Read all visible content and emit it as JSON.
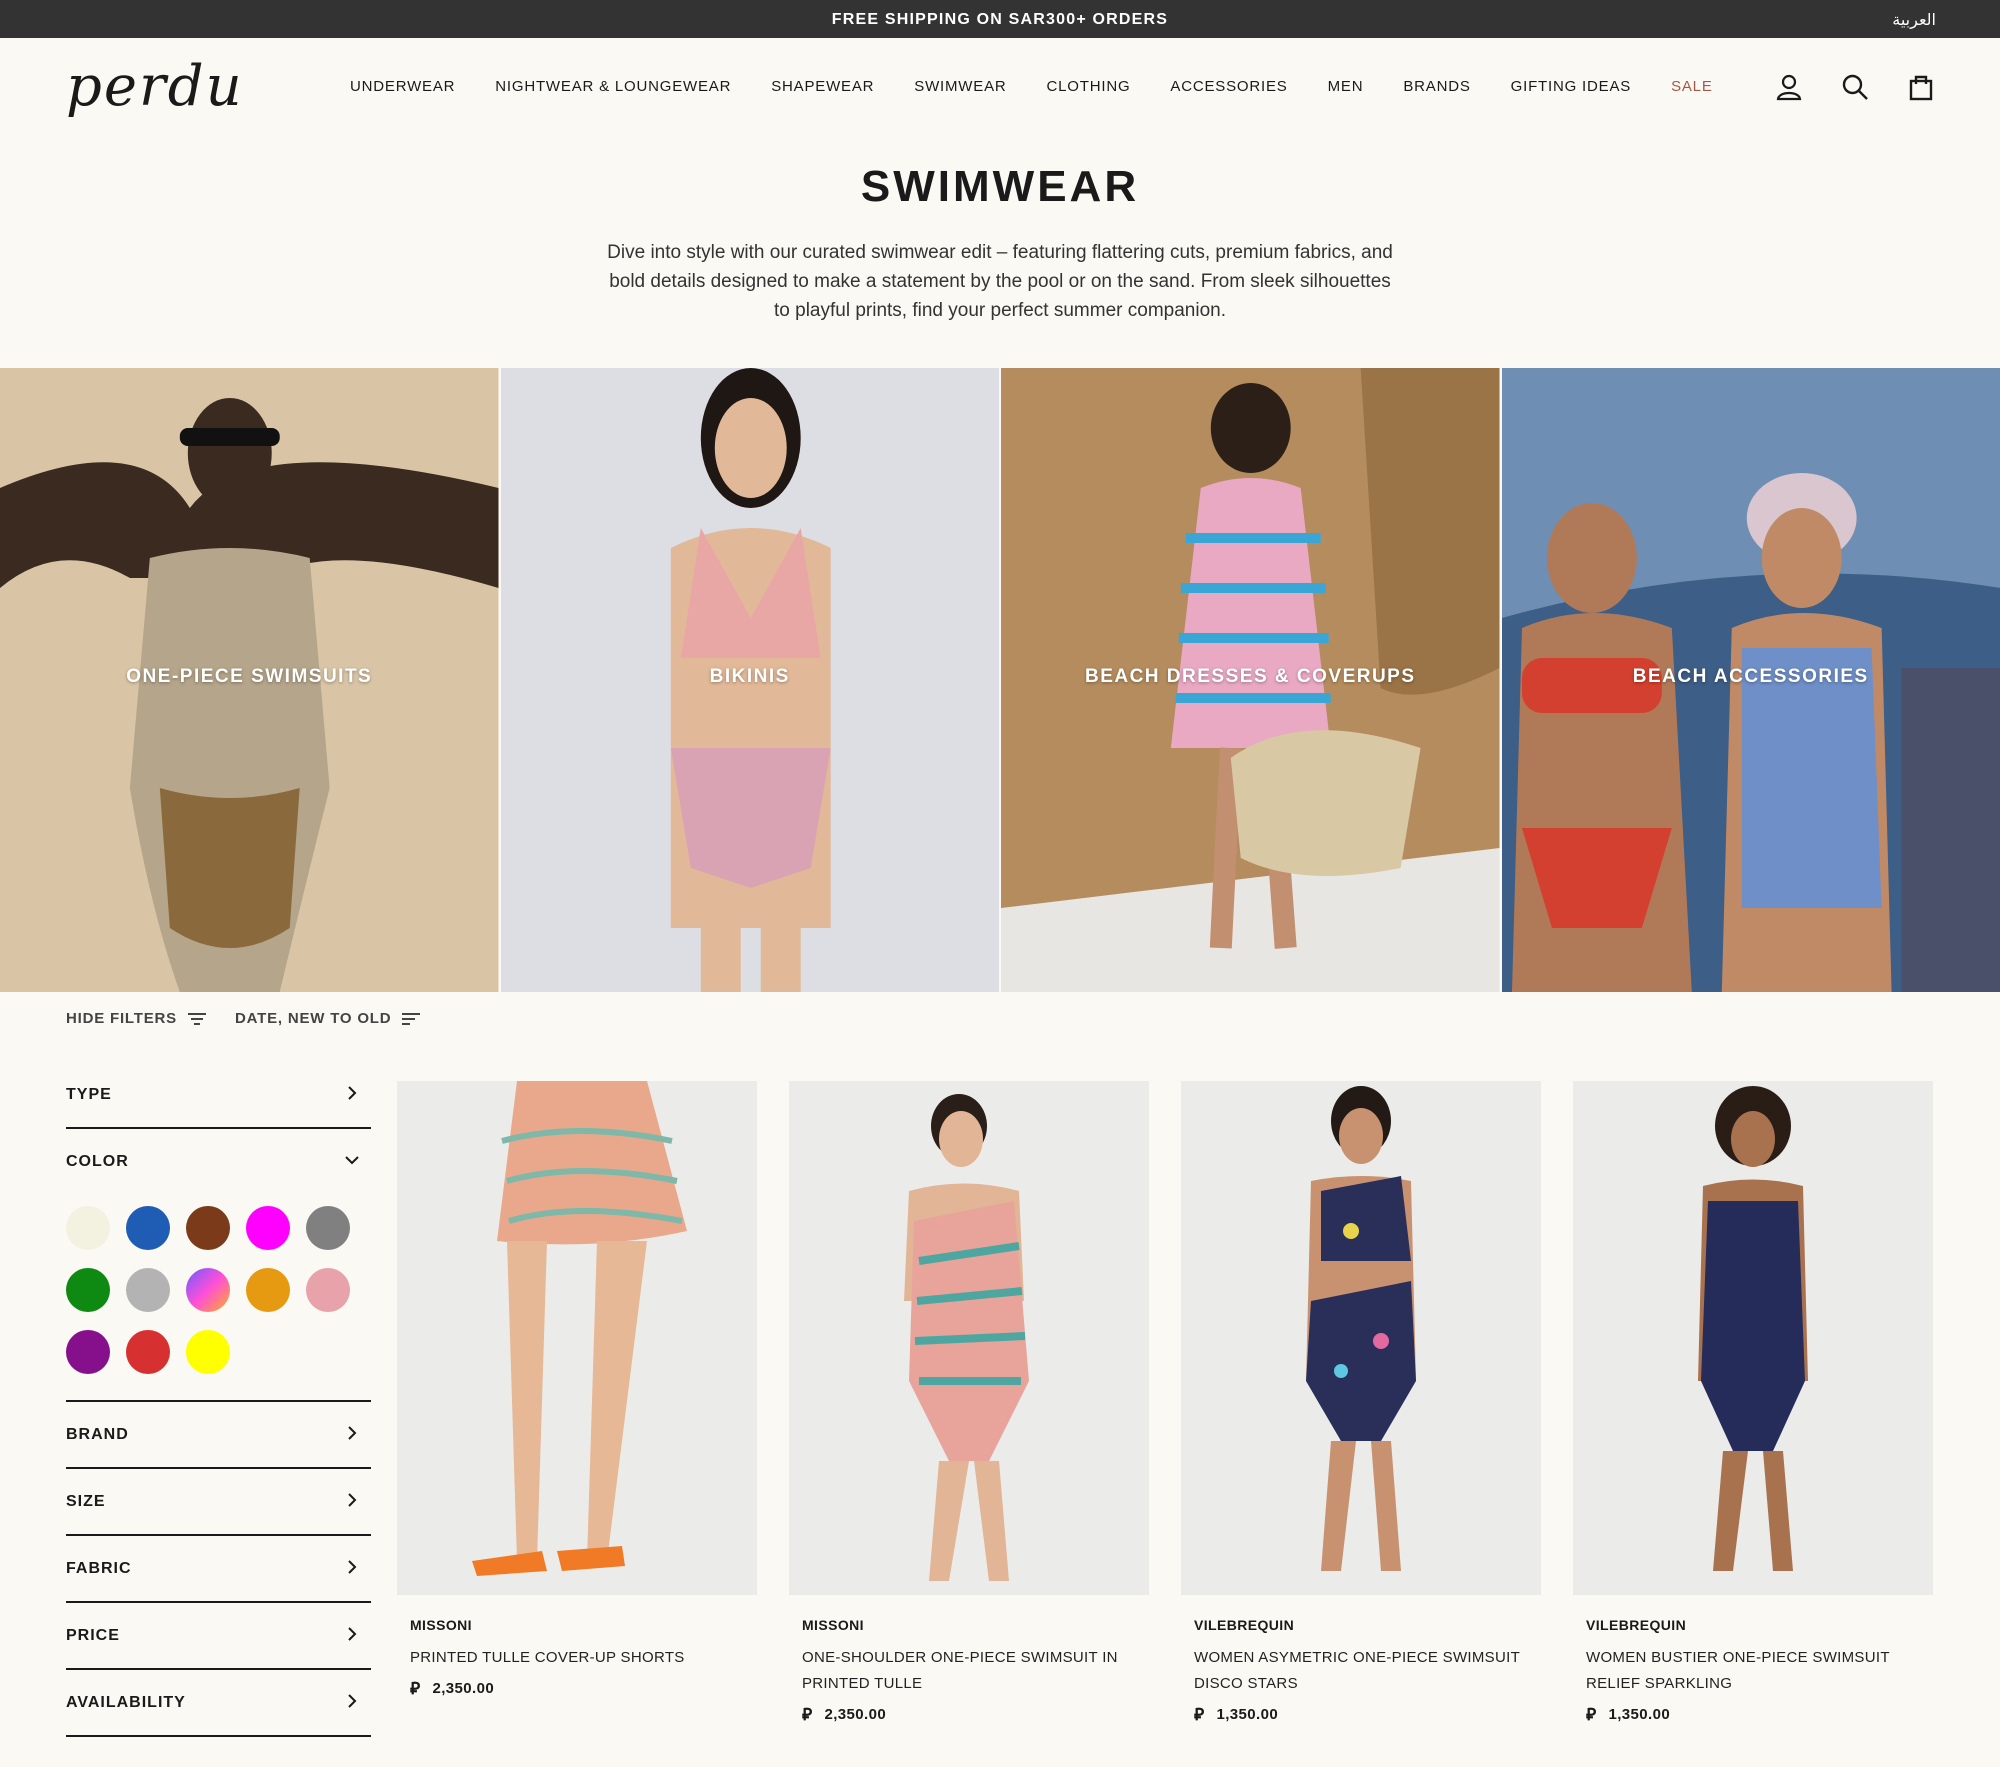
{
  "announcement": {
    "message": "FREE SHIPPING ON SAR300+ ORDERS",
    "language_switch": "العربية"
  },
  "header": {
    "logo": "perdu",
    "nav": [
      "UNDERWEAR",
      "NIGHTWEAR & LOUNGEWEAR",
      "SHAPEWEAR",
      "SWIMWEAR",
      "CLOTHING",
      "ACCESSORIES",
      "MEN",
      "BRANDS",
      "GIFTING IDEAS",
      "SALE"
    ],
    "icons": [
      "account-icon",
      "search-icon",
      "cart-icon"
    ]
  },
  "collection": {
    "title": "SWIMWEAR",
    "description": "Dive into style with our curated swimwear edit – featuring flattering cuts, premium fabrics, and bold details designed to make a statement by the pool or on the sand. From sleek silhouettes to playful prints, find your perfect summer companion."
  },
  "categories": [
    {
      "label": "ONE-PIECE SWIMSUITS"
    },
    {
      "label": "BIKINIS"
    },
    {
      "label": "BEACH DRESSES & COVERUPS"
    },
    {
      "label": "BEACH ACCESSORIES"
    }
  ],
  "toolbar": {
    "hide_filters": "HIDE FILTERS",
    "sort": "DATE, NEW TO OLD"
  },
  "filters": {
    "type": "TYPE",
    "color": "COLOR",
    "brand": "BRAND",
    "size": "SIZE",
    "fabric": "FABRIC",
    "price": "PRICE",
    "availability": "AVAILABILITY",
    "swatches": [
      "#f3f1df",
      "#1f5cb4",
      "#7b3a1a",
      "#ff00ff",
      "#808080",
      "#0e8a12",
      "#b3b3b3",
      "multicolor",
      "#e59a12",
      "#e8a2aa",
      "#86108c",
      "#d63030",
      "#ffff00"
    ]
  },
  "products": [
    {
      "brand": "MISSONI",
      "name": "PRINTED TULLE COVER-UP SHORTS",
      "currency": "⃁",
      "price": "2,350.00"
    },
    {
      "brand": "MISSONI",
      "name": "ONE-SHOULDER ONE-PIECE SWIMSUIT IN PRINTED TULLE",
      "currency": "⃁",
      "price": "2,350.00"
    },
    {
      "brand": "VILEBREQUIN",
      "name": "WOMEN ASYMETRIC ONE-PIECE SWIMSUIT DISCO STARS",
      "currency": "⃁",
      "price": "1,350.00"
    },
    {
      "brand": "VILEBREQUIN",
      "name": "WOMEN BUSTIER ONE-PIECE SWIMSUIT RELIEF SPARKLING",
      "currency": "⃁",
      "price": "1,350.00"
    }
  ]
}
